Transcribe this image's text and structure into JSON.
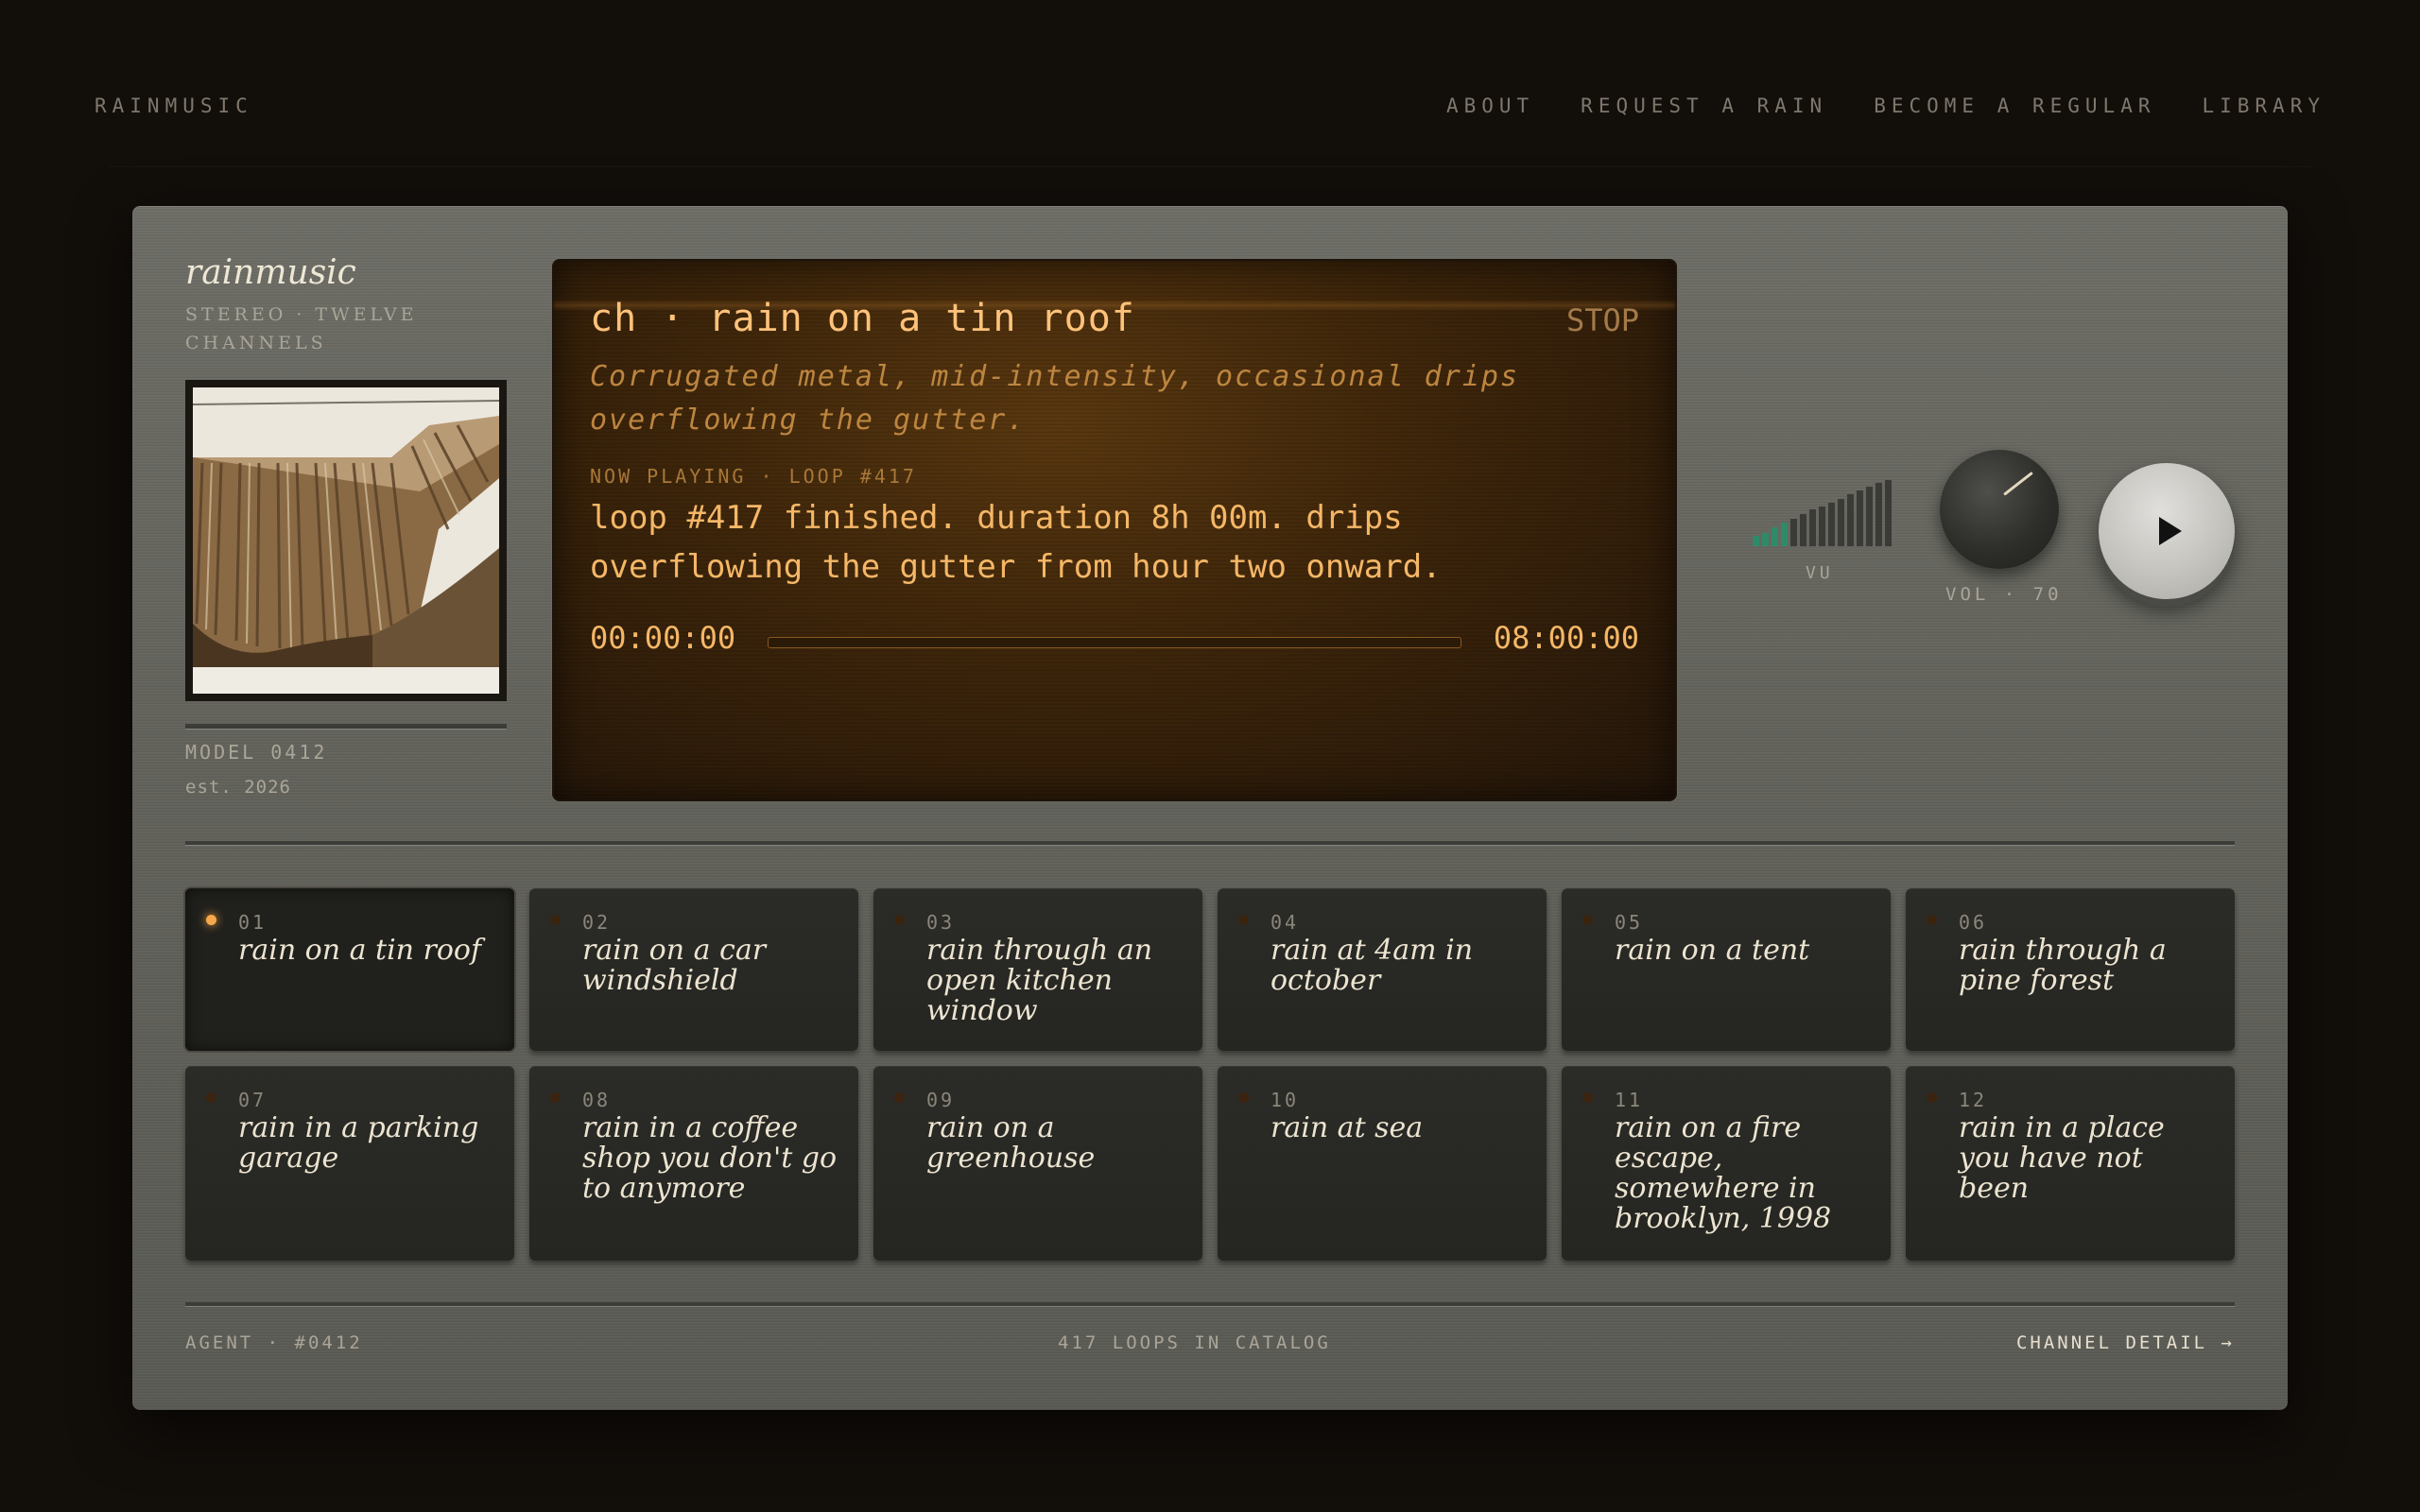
{
  "site": {
    "brand": "RAINMUSIC",
    "nav": [
      "ABOUT",
      "REQUEST A RAIN",
      "BECOME A REGULAR",
      "LIBRARY"
    ]
  },
  "device": {
    "logo": "rainmusic",
    "subtitle": "STEREO · TWELVE CHANNELS",
    "model": "MODEL 0412",
    "est": "est. 2026",
    "artwork_icon": "corrugated-tin-roof-illustration"
  },
  "screen": {
    "title": "ch · rain on a tin roof",
    "stop_label": "STOP",
    "description": "Corrugated metal, mid-intensity, occasional drips overflowing the gutter.",
    "now_playing": "NOW PLAYING · LOOP #417",
    "message": "loop #417 finished. duration 8h 00m. drips overflowing the gutter from hour two onward.",
    "time_elapsed": "00:00:00",
    "time_total": "08:00:00",
    "progress": 0
  },
  "controls": {
    "vu_label": "VU",
    "vu_levels": [
      0.15,
      0.2,
      0.28,
      0.36,
      0.42,
      0.48,
      0.55,
      0.6,
      0.66,
      0.72,
      0.78,
      0.84,
      0.9,
      0.95,
      1.0
    ],
    "vu_active_count": 4,
    "vu_active_color": "#2f8a6a",
    "volume_label": "VOL · 70",
    "volume": 70,
    "play_icon": "play-icon"
  },
  "channels": [
    {
      "num": "01",
      "name": "rain on a tin roof",
      "active": true
    },
    {
      "num": "02",
      "name": "rain on a car windshield",
      "active": false
    },
    {
      "num": "03",
      "name": "rain through an open kitchen window",
      "active": false
    },
    {
      "num": "04",
      "name": "rain at 4am in october",
      "active": false
    },
    {
      "num": "05",
      "name": "rain on a tent",
      "active": false
    },
    {
      "num": "06",
      "name": "rain through a pine forest",
      "active": false
    },
    {
      "num": "07",
      "name": "rain in a parking garage",
      "active": false
    },
    {
      "num": "08",
      "name": "rain in a coffee shop you don't go to anymore",
      "active": false
    },
    {
      "num": "09",
      "name": "rain on a greenhouse",
      "active": false
    },
    {
      "num": "10",
      "name": "rain at sea",
      "active": false
    },
    {
      "num": "11",
      "name": "rain on a fire escape, somewhere in brooklyn, 1998",
      "active": false
    },
    {
      "num": "12",
      "name": "rain in a place you have not been",
      "active": false
    }
  ],
  "footer": {
    "agent": "AGENT · #0412",
    "catalog": "417 LOOPS IN CATALOG",
    "detail_link": "CHANNEL DETAIL →"
  },
  "colors": {
    "amber": "#f5b767",
    "active_led": "#f7a84a",
    "background": "#120e0a"
  }
}
